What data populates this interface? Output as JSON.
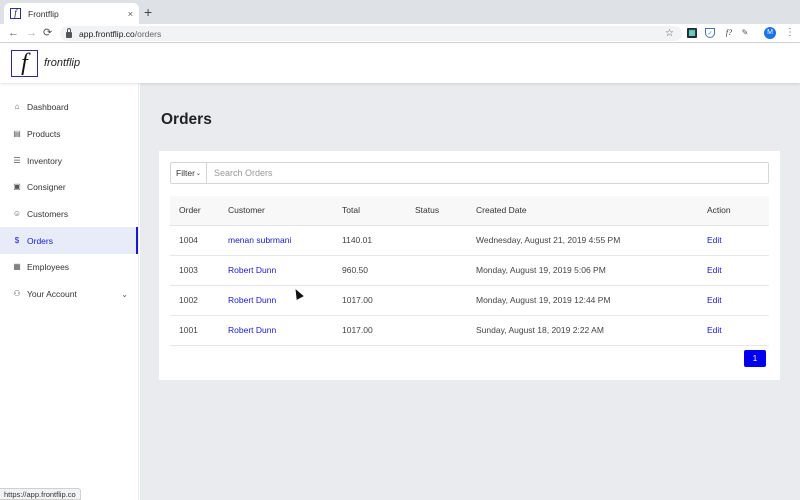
{
  "browser": {
    "tab_title": "Frontflip",
    "tab_favicon": "f",
    "tab_close": "×",
    "new_tab": "+",
    "url_host": "app.frontflip.co",
    "url_path": "/orders",
    "nav_back": "←",
    "nav_forward": "→",
    "nav_reload": "⟳",
    "star": "☆",
    "extension_f": "f?",
    "profile_initial": "M",
    "menu": "⋮",
    "status_url": "https://app.frontflip.co"
  },
  "header": {
    "logo_glyph": "f",
    "brand": "frontflip"
  },
  "sidebar": {
    "items": [
      {
        "label": "Dashboard",
        "icon": "home-icon",
        "glyph": "⌂"
      },
      {
        "label": "Products",
        "icon": "document-icon",
        "glyph": "▤"
      },
      {
        "label": "Inventory",
        "icon": "list-icon",
        "glyph": "☰"
      },
      {
        "label": "Consigner",
        "icon": "id-card-icon",
        "glyph": "▣"
      },
      {
        "label": "Customers",
        "icon": "smiley-icon",
        "glyph": "☺"
      },
      {
        "label": "Orders",
        "icon": "dollar-circle-icon",
        "glyph": "$",
        "active": true
      },
      {
        "label": "Employees",
        "icon": "badge-icon",
        "glyph": "▦"
      },
      {
        "label": "Your Account",
        "icon": "user-icon",
        "glyph": "⚇",
        "chevron": "⌄"
      }
    ]
  },
  "main": {
    "title": "Orders",
    "filter_label": "Filter",
    "filter_chevron": "⌄",
    "search_placeholder": "Search Orders",
    "table": {
      "headers": [
        "Order",
        "Customer",
        "Total",
        "Status",
        "Created Date",
        "Action"
      ],
      "rows": [
        {
          "order": "1004",
          "customer": "menan subrmani",
          "total": "1140.01",
          "status": "",
          "created": "Wednesday, August 21, 2019 4:55 PM",
          "action": "Edit"
        },
        {
          "order": "1003",
          "customer": "Robert Dunn",
          "total": "960.50",
          "status": "",
          "created": "Monday, August 19, 2019 5:06 PM",
          "action": "Edit"
        },
        {
          "order": "1002",
          "customer": "Robert Dunn",
          "total": "1017.00",
          "status": "",
          "created": "Monday, August 19, 2019 12:44 PM",
          "action": "Edit"
        },
        {
          "order": "1001",
          "customer": "Robert Dunn",
          "total": "1017.00",
          "status": "",
          "created": "Sunday, August 18, 2019 2:22 AM",
          "action": "Edit"
        }
      ]
    },
    "pagination": {
      "current_page": "1"
    }
  },
  "colors": {
    "accent": "#1a1acc",
    "page_button": "#0000ee",
    "main_background": "#eaebef"
  }
}
